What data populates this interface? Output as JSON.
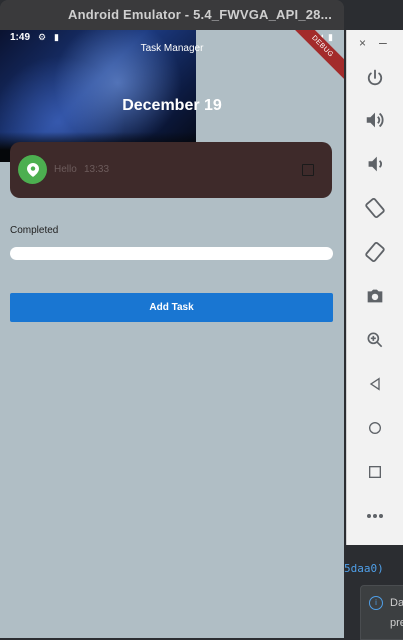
{
  "window": {
    "title": "Android Emulator - 5.4_FWVGA_API_28..."
  },
  "status_bar": {
    "time": "1:49",
    "ribbon": "DEBUG"
  },
  "app": {
    "title": "Task Manager",
    "date": "December 19"
  },
  "task": {
    "text": "Hello",
    "time": "13:33",
    "checked": false
  },
  "progress": {
    "label": "Completed",
    "value": 0
  },
  "actions": {
    "add_task_label": "Add Task"
  },
  "side_panel": {
    "close_label": "×",
    "minimize_label": "–",
    "tools": [
      "power-icon",
      "volume-up-icon",
      "volume-down-icon",
      "rotate-left-icon",
      "rotate-right-icon",
      "camera-icon",
      "zoom-icon",
      "back-icon",
      "home-icon",
      "overview-icon",
      "more-icon"
    ]
  },
  "ide": {
    "code_fragment": "5daa0)",
    "toast_line1": "Da",
    "toast_line2": "pre"
  },
  "colors": {
    "accent": "#1976d2",
    "screen_bg": "#b0bec5",
    "card_bg": "#3e2a2a",
    "avatar": "#4caf50"
  }
}
